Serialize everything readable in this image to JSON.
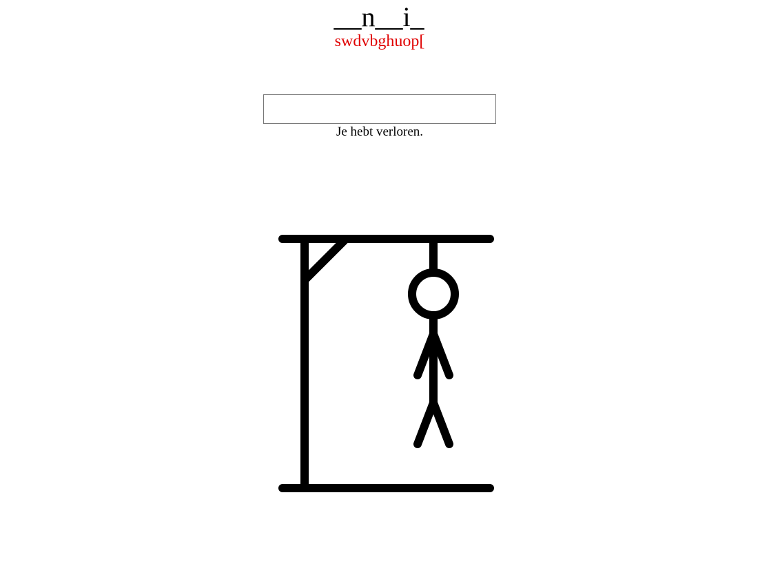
{
  "game": {
    "masked_word": "__n__i_",
    "wrong_letters": "swdvbghuop[",
    "guess_input": {
      "value": "",
      "placeholder": ""
    },
    "status_message": "Je hebt verloren.",
    "wrong_letters_color": "#e00000"
  }
}
